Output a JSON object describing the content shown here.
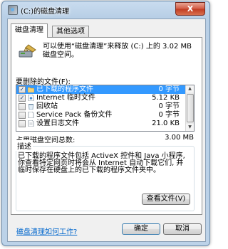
{
  "window": {
    "title": "(C:)的磁盘清理",
    "close_label": "X"
  },
  "tabs": [
    {
      "label": "磁盘清理",
      "active": true
    },
    {
      "label": "其他选项",
      "active": false
    }
  ],
  "header": {
    "text": "可以使用“磁盘清理”来释放 (C:) 上的 3.02 MB 磁盘空间。"
  },
  "files_label": "要删除的文件(F):",
  "files": [
    {
      "name": "已下载的程序文件",
      "size": "0 字节",
      "checked": true,
      "selected": true,
      "icon": "folder-icon"
    },
    {
      "name": "Internet 临时文件",
      "size": "5.12 KB",
      "checked": true,
      "selected": false,
      "icon": "file-icon"
    },
    {
      "name": "回收站",
      "size": "0 字节",
      "checked": false,
      "selected": false,
      "icon": "recycle-bin-icon"
    },
    {
      "name": "Service Pack 备份文件",
      "size": "0 字节",
      "checked": false,
      "selected": false,
      "icon": "file-icon"
    },
    {
      "name": "设置日志文件",
      "size": "21.0 KB",
      "checked": false,
      "selected": false,
      "icon": "file-icon"
    }
  ],
  "space": {
    "label": "占用磁盘空间总数:",
    "value": "3.00 MB"
  },
  "description": {
    "title": "描述",
    "text": "已下载的程序文件包括 ActiveX 控件和 Java 小程序, 你查看特定网页时将会从 Internet 自动下载它们, 并临时保存在硬盘上的已下载的程序文件夹中。"
  },
  "view_files_label": "查看文件(V)",
  "help_link": "磁盘清理如何工作?",
  "ok_label": "确定",
  "cancel_label": "取消"
}
